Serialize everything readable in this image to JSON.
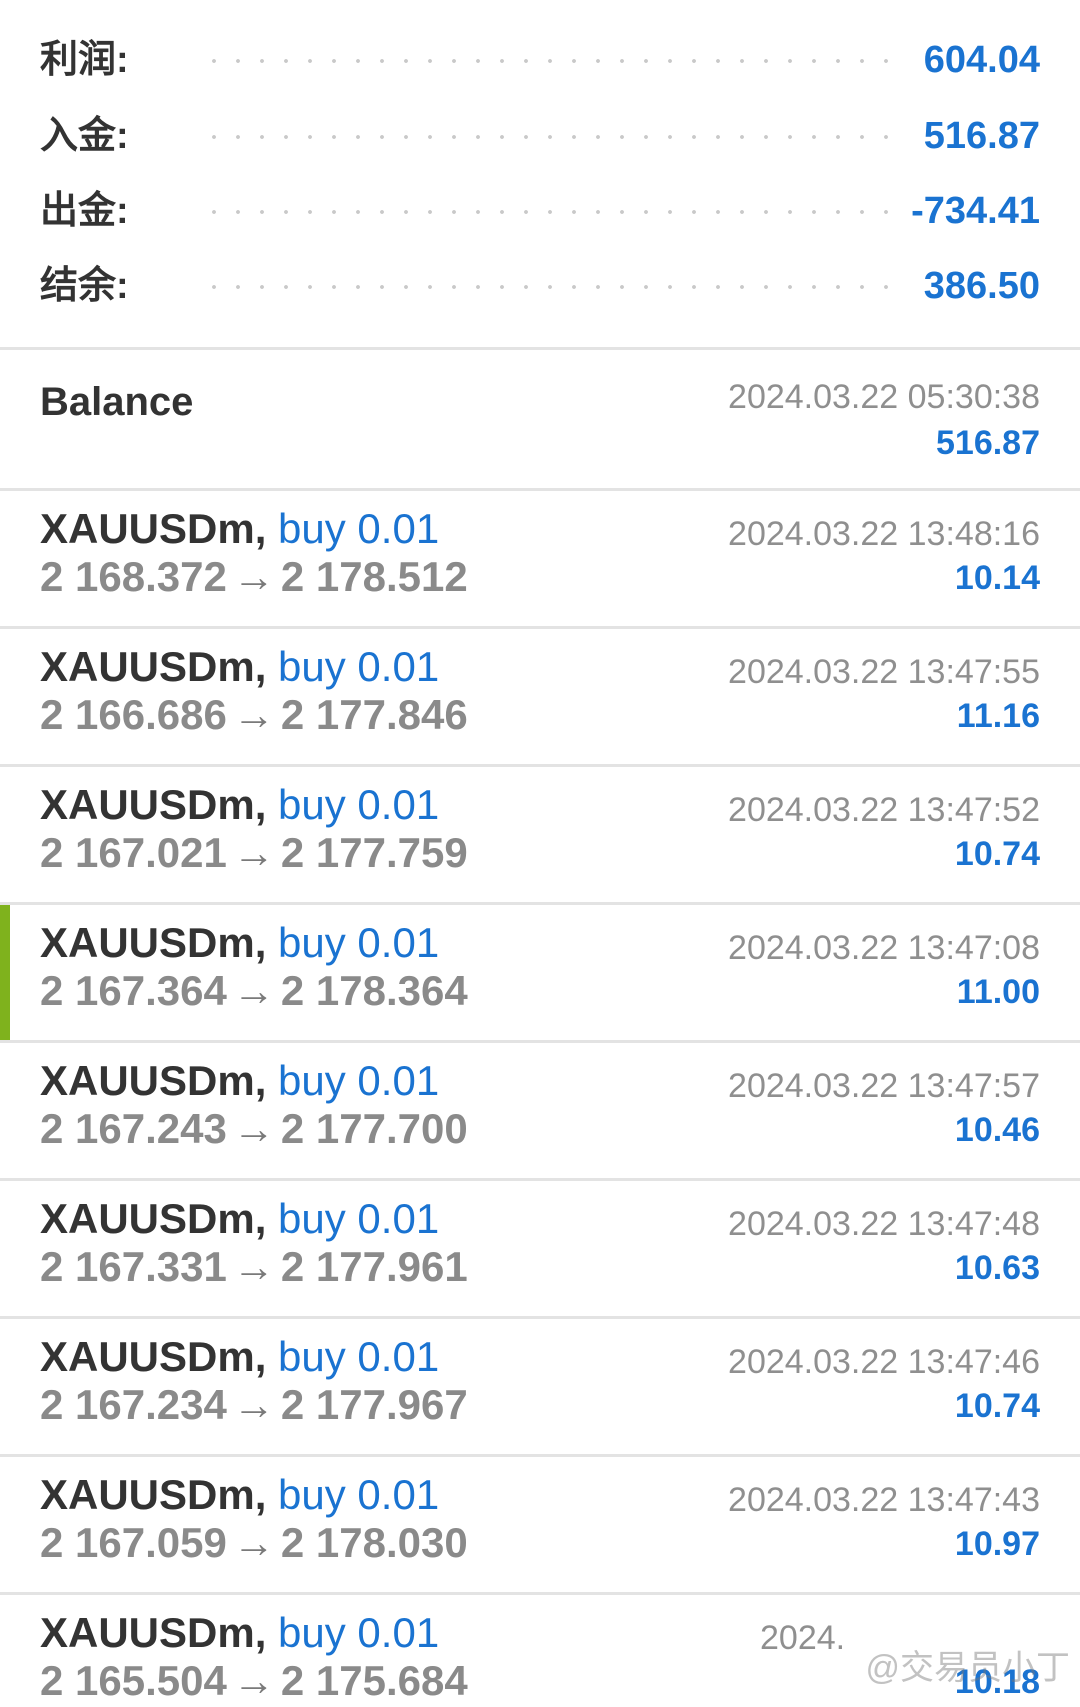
{
  "summary": {
    "profit": {
      "label": "利润:",
      "value": "604.04"
    },
    "deposit": {
      "label": "入金:",
      "value": "516.87"
    },
    "withdrawal": {
      "label": "出金:",
      "value": "-734.41"
    },
    "balance": {
      "label": "结余:",
      "value": "386.50"
    }
  },
  "balance_entry": {
    "title": "Balance",
    "time": "2024.03.22 05:30:38",
    "amount": "516.87"
  },
  "trades": [
    {
      "symbol": "XAUUSDm,",
      "side": "buy 0.01",
      "open": "2 168.372",
      "close": "2 178.512",
      "time": "2024.03.22 13:48:16",
      "profit": "10.14"
    },
    {
      "symbol": "XAUUSDm,",
      "side": "buy 0.01",
      "open": "2 166.686",
      "close": "2 177.846",
      "time": "2024.03.22 13:47:55",
      "profit": "11.16"
    },
    {
      "symbol": "XAUUSDm,",
      "side": "buy 0.01",
      "open": "2 167.021",
      "close": "2 177.759",
      "time": "2024.03.22 13:47:52",
      "profit": "10.74"
    },
    {
      "symbol": "XAUUSDm,",
      "side": "buy 0.01",
      "open": "2 167.364",
      "close": "2 178.364",
      "time": "2024.03.22 13:47:08",
      "profit": "11.00"
    },
    {
      "symbol": "XAUUSDm,",
      "side": "buy 0.01",
      "open": "2 167.243",
      "close": "2 177.700",
      "time": "2024.03.22 13:47:57",
      "profit": "10.46"
    },
    {
      "symbol": "XAUUSDm,",
      "side": "buy 0.01",
      "open": "2 167.331",
      "close": "2 177.961",
      "time": "2024.03.22 13:47:48",
      "profit": "10.63"
    },
    {
      "symbol": "XAUUSDm,",
      "side": "buy 0.01",
      "open": "2 167.234",
      "close": "2 177.967",
      "time": "2024.03.22 13:47:46",
      "profit": "10.74"
    },
    {
      "symbol": "XAUUSDm,",
      "side": "buy 0.01",
      "open": "2 167.059",
      "close": "2 178.030",
      "time": "2024.03.22 13:47:43",
      "profit": "10.97"
    },
    {
      "symbol": "XAUUSDm,",
      "side": "buy 0.01",
      "open": "2 165.504",
      "close": "2 175.684",
      "time": "",
      "profit": "10.18"
    }
  ],
  "arrow_glyph": "→",
  "watermark": "@交易员小丁",
  "watermark_partial_time": "2024.",
  "colors": {
    "accent_blue": "#1a73d1",
    "selected_marker": "#7fb21d",
    "label_dark": "#333333",
    "muted_gray": "#8f8f8f"
  }
}
